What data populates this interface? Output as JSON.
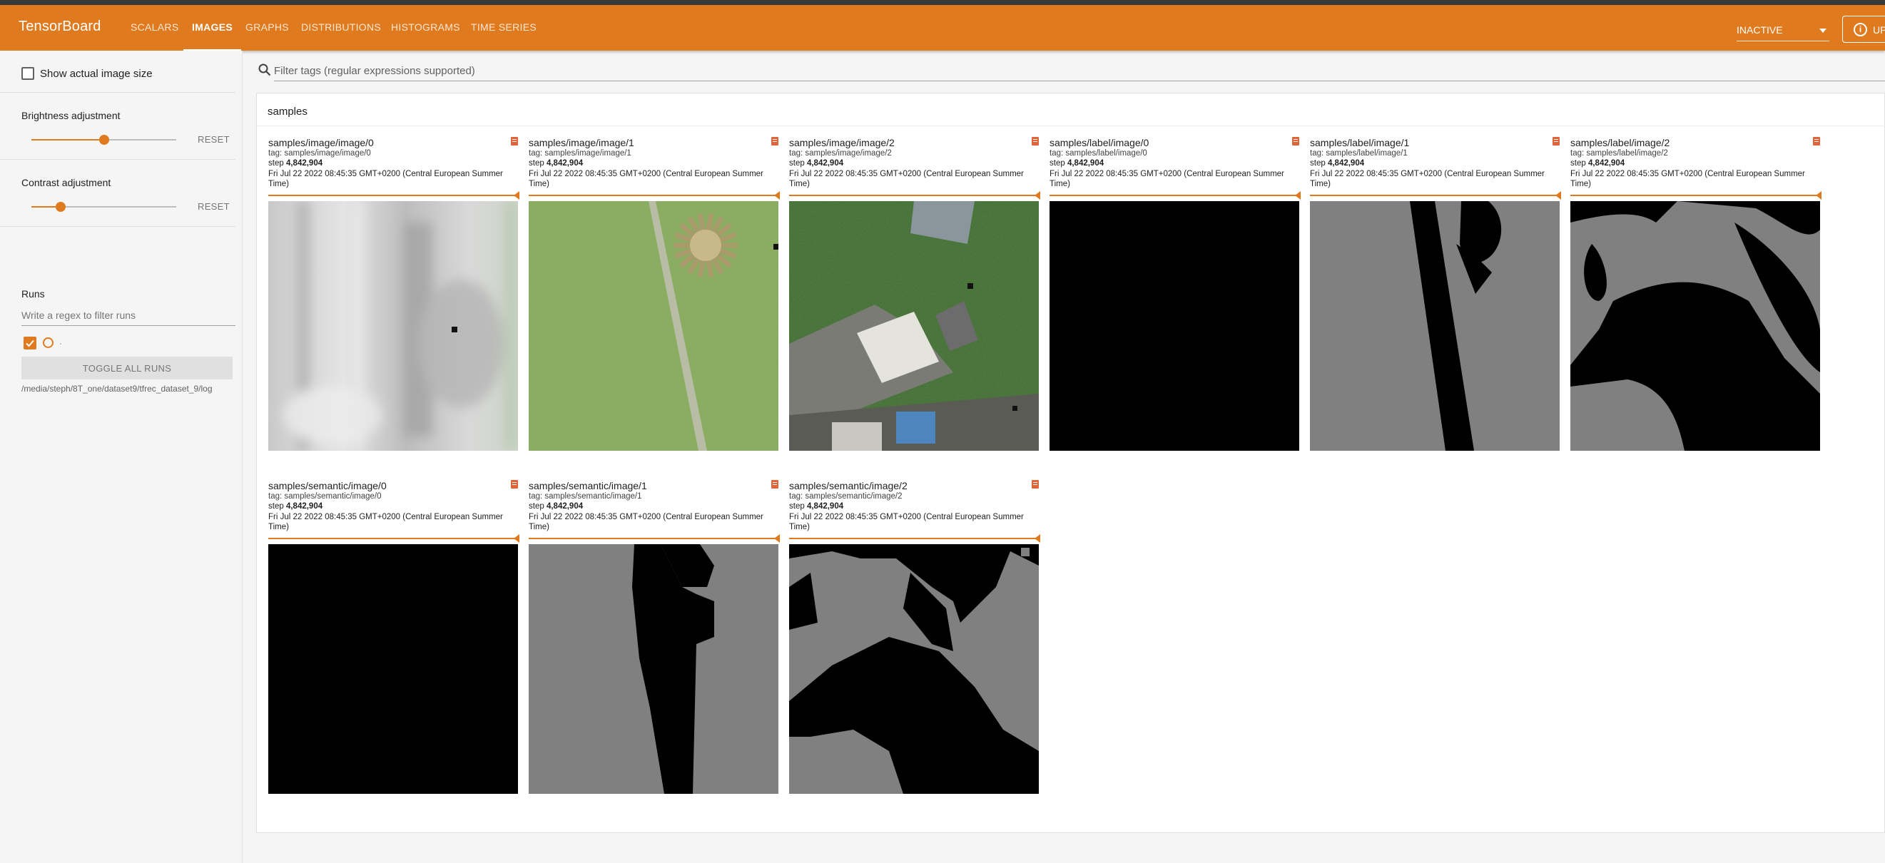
{
  "app": {
    "title": "TensorBoard",
    "nav": [
      "SCALARS",
      "IMAGES",
      "GRAPHS",
      "DISTRIBUTIONS",
      "HISTOGRAMS",
      "TIME SERIES"
    ],
    "active_tab": "IMAGES",
    "run_status": "INACTIVE",
    "upload_label": "UP",
    "accent_color": "#e07a1f"
  },
  "sidebar": {
    "show_actual_size_label": "Show actual image size",
    "show_actual_size_checked": false,
    "brightness": {
      "label": "Brightness adjustment",
      "reset": "RESET",
      "value": 0.5
    },
    "contrast": {
      "label": "Contrast adjustment",
      "reset": "RESET",
      "value": 0.2
    },
    "runs": {
      "title": "Runs",
      "filter_placeholder": "Write a regex to filter runs",
      "run_name": ".",
      "run_checked": true,
      "toggle_label": "TOGGLE ALL RUNS",
      "log_dir": "/media/steph/8T_one/dataset9/tfrec_dataset_9/log"
    }
  },
  "main": {
    "tag_filter_placeholder": "Filter tags (regular expressions supported)",
    "group_title": "samples",
    "panels": [
      {
        "title": "samples/image/image/0",
        "tag": "tag: samples/image/image/0",
        "step_label": "step",
        "step": "4,842,904",
        "time": "Fri Jul 22 2022 08:45:35 GMT+0200 (Central European Summer Time)",
        "image": "gray-blurred"
      },
      {
        "title": "samples/image/image/1",
        "tag": "tag: samples/image/image/1",
        "step_label": "step",
        "step": "4,842,904",
        "time": "Fri Jul 22 2022 08:45:35 GMT+0200 (Central European Summer Time)",
        "image": "grass-tree"
      },
      {
        "title": "samples/image/image/2",
        "tag": "tag: samples/image/image/2",
        "step_label": "step",
        "step": "4,842,904",
        "time": "Fri Jul 22 2022 08:45:35 GMT+0200 (Central European Summer Time)",
        "image": "aerial-buildings"
      },
      {
        "title": "samples/label/image/0",
        "tag": "tag: samples/label/image/0",
        "step_label": "step",
        "step": "4,842,904",
        "time": "Fri Jul 22 2022 08:45:35 GMT+0200 (Central European Summer Time)",
        "image": "black"
      },
      {
        "title": "samples/label/image/1",
        "tag": "tag: samples/label/image/1",
        "step_label": "step",
        "step": "4,842,904",
        "time": "Fri Jul 22 2022 08:45:35 GMT+0200 (Central European Summer Time)",
        "image": "mask-path"
      },
      {
        "title": "samples/label/image/2",
        "tag": "tag: samples/label/image/2",
        "step_label": "step",
        "step": "4,842,904",
        "time": "Fri Jul 22 2022 08:45:35 GMT+0200 (Central European Summer Time)",
        "image": "mask-blobs"
      },
      {
        "title": "samples/semantic/image/0",
        "tag": "tag: samples/semantic/image/0",
        "step_label": "step",
        "step": "4,842,904",
        "time": "Fri Jul 22 2022 08:45:35 GMT+0200 (Central European Summer Time)",
        "image": "black"
      },
      {
        "title": "samples/semantic/image/1",
        "tag": "tag: samples/semantic/image/1",
        "step_label": "step",
        "step": "4,842,904",
        "time": "Fri Jul 22 2022 08:45:35 GMT+0200 (Central European Summer Time)",
        "image": "pixel-path"
      },
      {
        "title": "samples/semantic/image/2",
        "tag": "tag: samples/semantic/image/2",
        "step_label": "step",
        "step": "4,842,904",
        "time": "Fri Jul 22 2022 08:45:35 GMT+0200 (Central European Summer Time)",
        "image": "pixel-blobs"
      }
    ]
  }
}
